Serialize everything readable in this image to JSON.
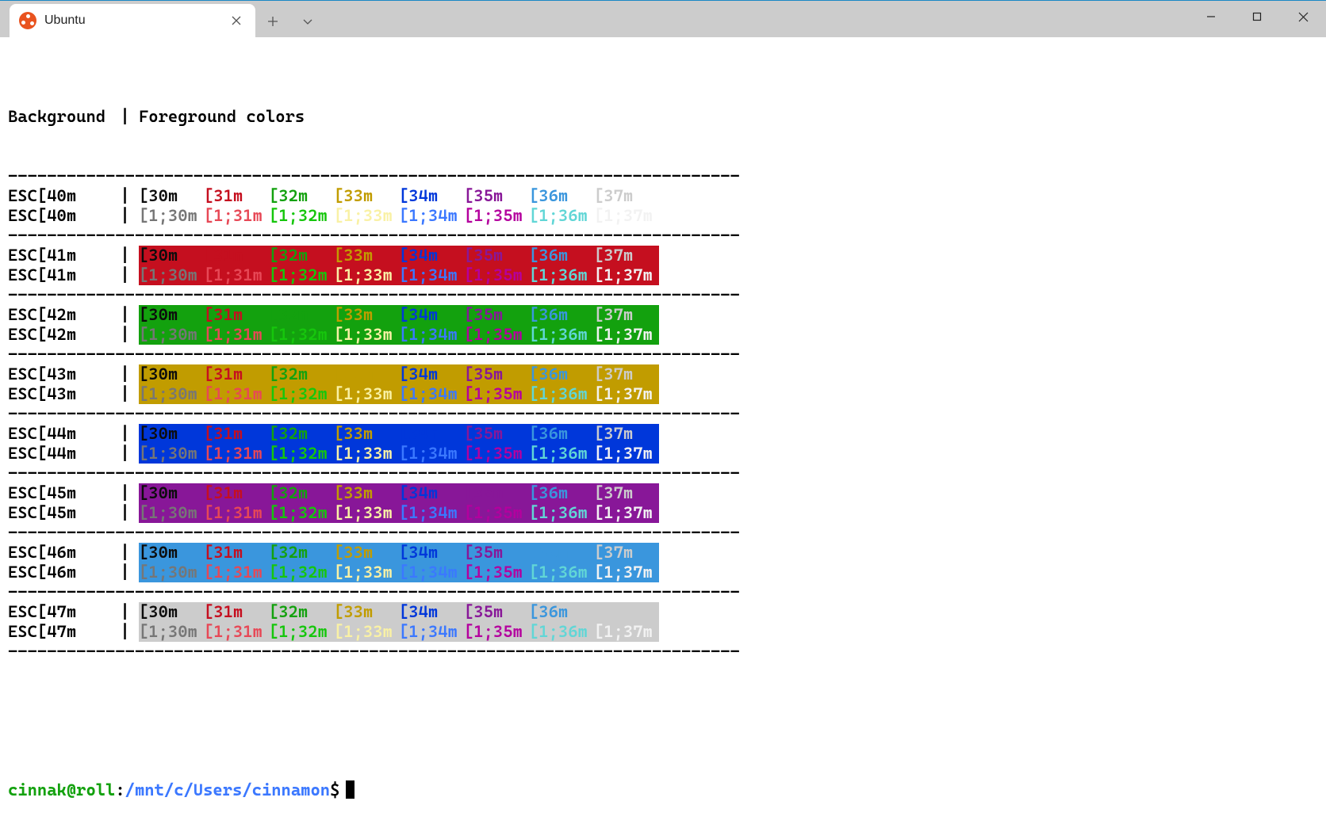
{
  "window": {
    "tab_title": "Ubuntu"
  },
  "header": {
    "bg_label": "Background",
    "fg_label": "Foreground colors",
    "pipe": "|"
  },
  "separator_line": "---------------------------------------------------------------------------",
  "table": {
    "fg_codes_normal": [
      "[30m",
      "[31m",
      "[32m",
      "[33m",
      "[34m",
      "[35m",
      "[36m",
      "[37m"
    ],
    "fg_codes_bold": [
      "[1;30m",
      "[1;31m",
      "[1;32m",
      "[1;33m",
      "[1;34m",
      "[1;35m",
      "[1;36m",
      "[1;37m"
    ],
    "fg_classes_normal": [
      "fg30",
      "fg31",
      "fg32",
      "fg33",
      "fg34",
      "fg35",
      "fg36",
      "fg37"
    ],
    "fg_classes_bold": [
      "fg130",
      "fg131",
      "fg132",
      "fg133",
      "fg134",
      "fg135",
      "fg136",
      "fg137"
    ],
    "bg_blocks": [
      {
        "code": "40",
        "label": "ESC[40m",
        "bg_class": "bg40"
      },
      {
        "code": "41",
        "label": "ESC[41m",
        "bg_class": "bg41"
      },
      {
        "code": "42",
        "label": "ESC[42m",
        "bg_class": "bg42"
      },
      {
        "code": "43",
        "label": "ESC[43m",
        "bg_class": "bg43"
      },
      {
        "code": "44",
        "label": "ESC[44m",
        "bg_class": "bg44"
      },
      {
        "code": "45",
        "label": "ESC[45m",
        "bg_class": "bg45"
      },
      {
        "code": "46",
        "label": "ESC[46m",
        "bg_class": "bg46"
      },
      {
        "code": "47",
        "label": "ESC[47m",
        "bg_class": "bg47"
      }
    ]
  },
  "prompt": {
    "user_host": "cinnak@roll",
    "colon": ":",
    "cwd": "/mnt/c/Users/cinnamon",
    "sigil": "$"
  },
  "colors": {
    "normal": {
      "30": "#0c0c0c",
      "31": "#c50f1f",
      "32": "#13a10e",
      "33": "#c19c00",
      "34": "#0037da",
      "35": "#881798",
      "36": "#3a96dd",
      "37": "#cccccc"
    },
    "bold": {
      "30": "#767676",
      "31": "#e74856",
      "32": "#16c60c",
      "33": "#f9f1a5",
      "34": "#3b78ff",
      "35": "#b4009e",
      "36": "#61d6d6",
      "37": "#f2f2f2"
    },
    "bg": {
      "40": "#ffffff",
      "41": "#c50f1f",
      "42": "#13a10e",
      "43": "#c19c00",
      "44": "#0037da",
      "45": "#881798",
      "46": "#3a96dd",
      "47": "#cccccc"
    }
  }
}
